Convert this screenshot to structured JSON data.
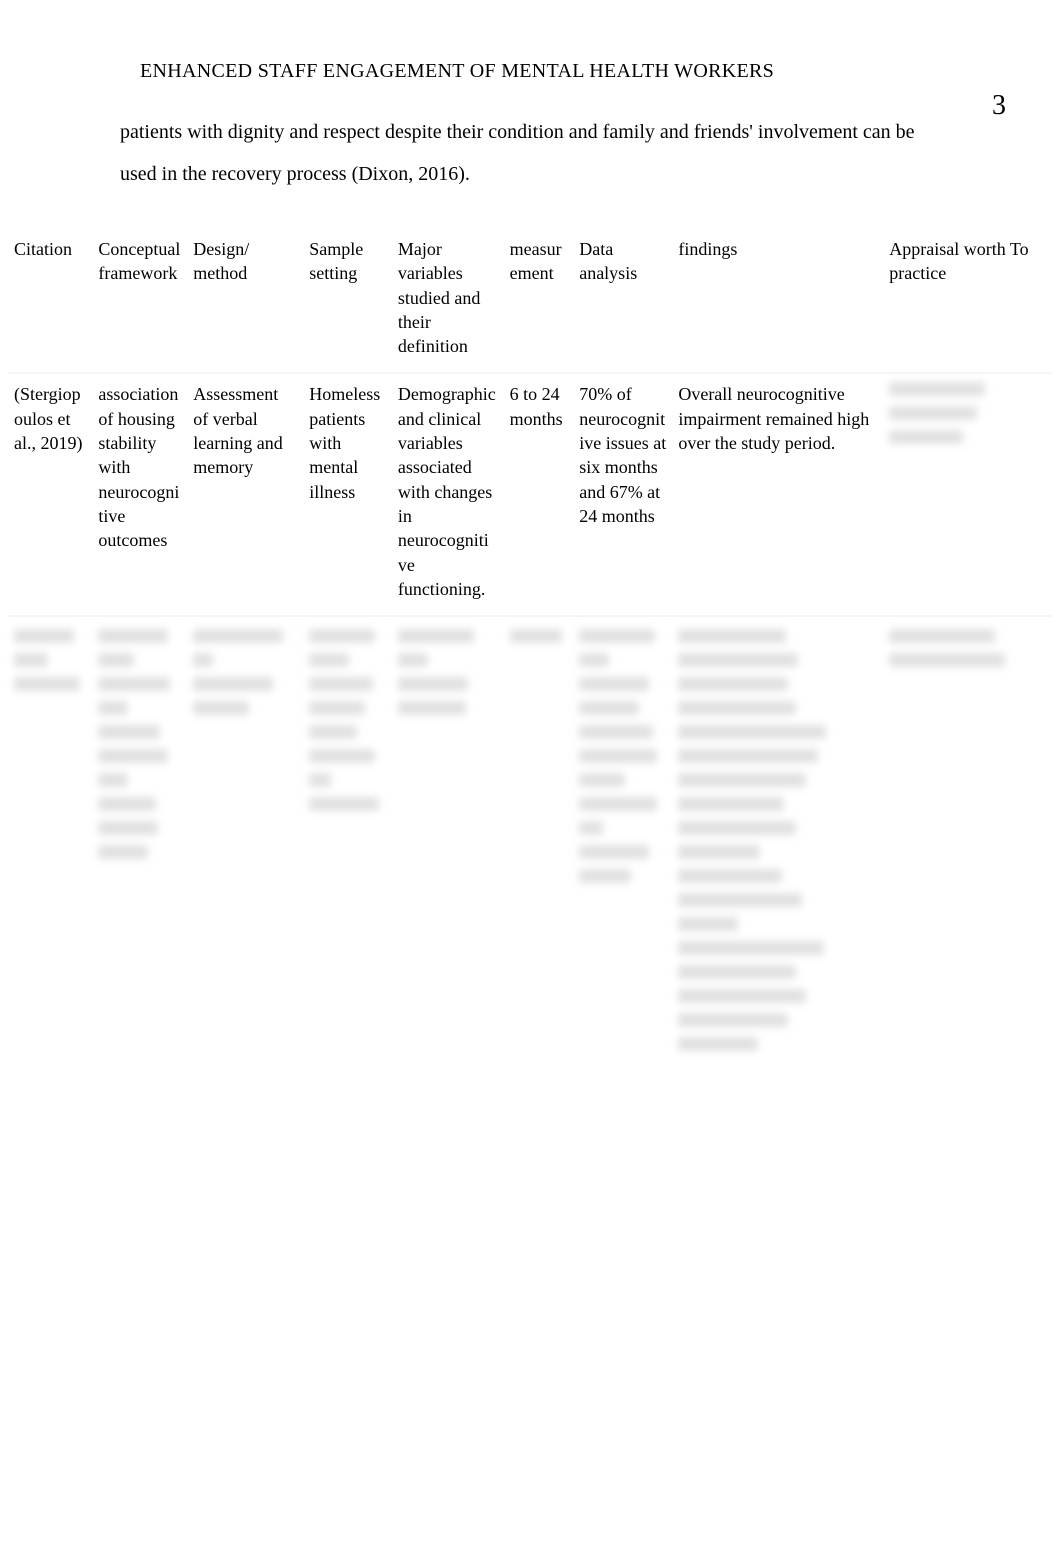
{
  "running_head": "ENHANCED STAFF ENGAGEMENT OF MENTAL HEALTH WORKERS",
  "page_number": "3",
  "paragraph": "patients with dignity and respect despite their condition and family and friends' involvement can be used in the recovery process (Dixon, 2016).",
  "table": {
    "headers": [
      "Citation",
      "Conceptual\nframework",
      "Design/\nmethod",
      "Sample\nsetting",
      "Major variables studied and their definition",
      "measurement",
      "Data analysis",
      "findings",
      "Appraisal worth\nTo practice"
    ],
    "rows": [
      {
        "citation": "(Stergiopoulos et al., 2019)",
        "framework": " association of housing stability with neurocognitive outcomes",
        "design": "Assessment of verbal learning and memory",
        "sample": "Homeless patients with mental illness",
        "variables": " Demographic and clinical variables associated with changes in neurocognitive functioning.",
        "measurement": "6 to 24 months",
        "analysis": "70% of neurocognitive issues at six months and 67% at 24 months",
        "findings": "Overall neurocognitive impairment remained high over the study period.",
        "appraisal": ""
      }
    ]
  },
  "blur_row": {
    "cols": [
      [
        60,
        34,
        66
      ],
      [
        70,
        36,
        72,
        30,
        62,
        70,
        30,
        58,
        60,
        50
      ],
      [
        90,
        20,
        80,
        56
      ],
      [
        66,
        40,
        64,
        56,
        48,
        66,
        22,
        70
      ],
      [
        76,
        30,
        70,
        68
      ],
      [
        52
      ],
      [
        76,
        30,
        70,
        60,
        74,
        78,
        46,
        78,
        24,
        70,
        52
      ],
      [
        108,
        120,
        110,
        118,
        148,
        140,
        128,
        106,
        118,
        82,
        104,
        124,
        60,
        146,
        118,
        128,
        110,
        80
      ],
      [
        106,
        116
      ]
    ]
  }
}
